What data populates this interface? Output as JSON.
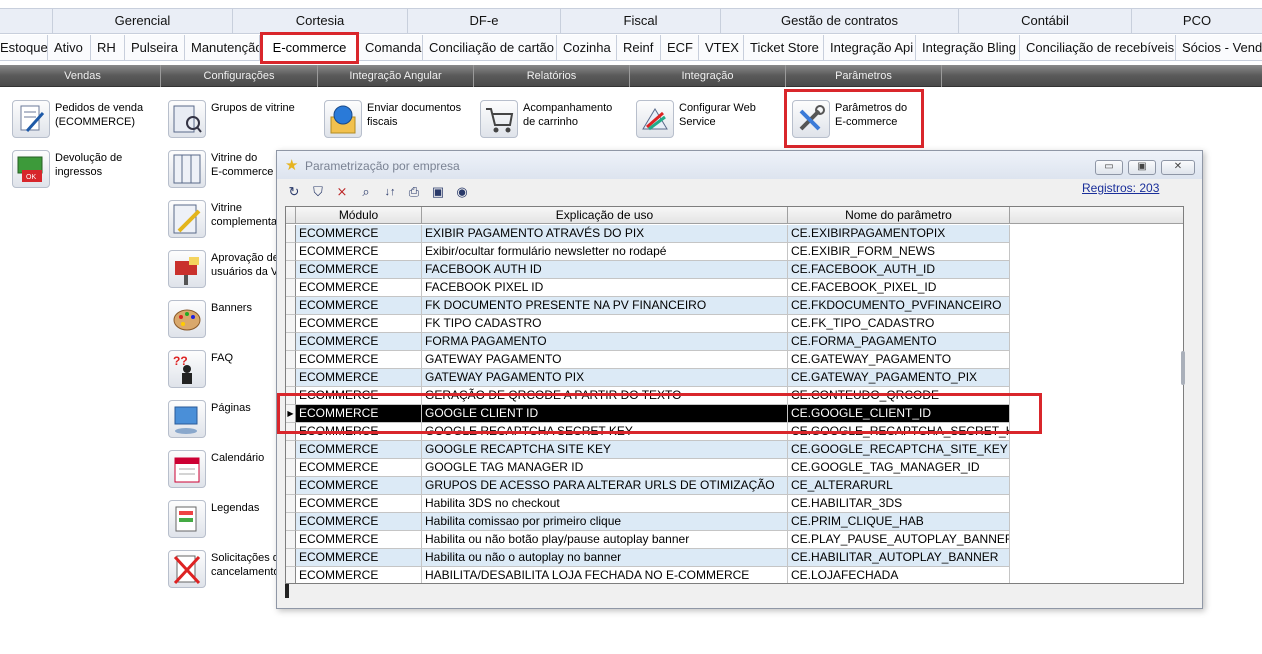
{
  "top_menu": [
    "Gerencial",
    "Cortesia",
    "DF-e",
    "Fiscal",
    "Gestão de contratos",
    "Contábil",
    "PCO"
  ],
  "modules": [
    "Estoque",
    "Ativo",
    "RH",
    "Pulseira",
    "Manutenção",
    "E-commerce",
    "Comanda",
    "Conciliação de cartão",
    "Cozinha",
    "Reinf",
    "ECF",
    "VTEX",
    "Ticket Store",
    "Integração Api",
    "Integração Bling",
    "Conciliação de recebíveis",
    "Sócios - Venda"
  ],
  "selected_module": "E-commerce",
  "sub_menu": [
    "Vendas",
    "Configurações",
    "Integração Angular",
    "Relatórios",
    "Integração",
    "Parâmetros"
  ],
  "tiles": {
    "pedidos": "Pedidos de venda\n(ECOMMERCE)",
    "devolucao": "Devolução de\ningressos",
    "grupos_vitrine": "Grupos de vitrine",
    "vitrine_ecommerce": "Vitrine do\nE-commerce",
    "vitrine_complementar": "Vitrine\ncomplementar",
    "aprovacao": "Aprovação de\nusuários da V",
    "banners": "Banners",
    "faq": "FAQ",
    "paginas": "Páginas",
    "calendario": "Calendário",
    "legendas": "Legendas",
    "solicitacoes": "Solicitações d\ncancelamento",
    "enviar_docs": "Enviar documentos\nfiscais",
    "carrinho": "Acompanhamento\nde carrinho",
    "web_service": "Configurar Web\nService",
    "parametros": "Parâmetros do\nE-commerce"
  },
  "dialog": {
    "title": "Parametrização por empresa",
    "registros": "Registros: 203",
    "columns": [
      "Módulo",
      "Explicação de uso",
      "Nome do parâmetro"
    ],
    "rows": [
      [
        "ECOMMERCE",
        "EXIBIR PAGAMENTO ATRAVÉS DO PIX",
        "CE.EXIBIRPAGAMENTOPIX"
      ],
      [
        "ECOMMERCE",
        "Exibir/ocultar formulário newsletter no rodapé",
        "CE.EXIBIR_FORM_NEWS"
      ],
      [
        "ECOMMERCE",
        "FACEBOOK AUTH ID",
        "CE.FACEBOOK_AUTH_ID"
      ],
      [
        "ECOMMERCE",
        "FACEBOOK PIXEL ID",
        "CE.FACEBOOK_PIXEL_ID"
      ],
      [
        "ECOMMERCE",
        "FK DOCUMENTO PRESENTE NA PV FINANCEIRO",
        "CE.FKDOCUMENTO_PVFINANCEIRO"
      ],
      [
        "ECOMMERCE",
        "FK TIPO CADASTRO",
        "CE.FK_TIPO_CADASTRO"
      ],
      [
        "ECOMMERCE",
        "FORMA PAGAMENTO",
        "CE.FORMA_PAGAMENTO"
      ],
      [
        "ECOMMERCE",
        "GATEWAY PAGAMENTO",
        "CE.GATEWAY_PAGAMENTO"
      ],
      [
        "ECOMMERCE",
        "GATEWAY PAGAMENTO PIX",
        "CE.GATEWAY_PAGAMENTO_PIX"
      ],
      [
        "ECOMMERCE",
        "GERAÇÃO DE QRCODE A PARTIR DO TEXTO",
        "CE.CONTEUDO_QRCODE"
      ],
      [
        "ECOMMERCE",
        "GOOGLE CLIENT ID",
        "CE.GOOGLE_CLIENT_ID"
      ],
      [
        "ECOMMERCE",
        "GOOGLE RECAPTCHA SECRET KEY",
        "CE.GOOGLE_RECAPTCHA_SECRET_K"
      ],
      [
        "ECOMMERCE",
        "GOOGLE RECAPTCHA SITE KEY",
        "CE.GOOGLE_RECAPTCHA_SITE_KEY"
      ],
      [
        "ECOMMERCE",
        "GOOGLE TAG MANAGER ID",
        "CE.GOOGLE_TAG_MANAGER_ID"
      ],
      [
        "ECOMMERCE",
        "GRUPOS DE ACESSO PARA ALTERAR URLS DE OTIMIZAÇÃO",
        "CE_ALTERARURL"
      ],
      [
        "ECOMMERCE",
        "Habilita 3DS no checkout",
        "CE.HABILITAR_3DS"
      ],
      [
        "ECOMMERCE",
        "Habilita comissao por primeiro clique",
        "CE.PRIM_CLIQUE_HAB"
      ],
      [
        "ECOMMERCE",
        "Habilita ou não botão play/pause autoplay banner",
        "CE.PLAY_PAUSE_AUTOPLAY_BANNER"
      ],
      [
        "ECOMMERCE",
        "Habilita ou não o autoplay no banner",
        "CE.HABILITAR_AUTOPLAY_BANNER"
      ],
      [
        "ECOMMERCE",
        "HABILITA/DESABILITA LOJA FECHADA NO E-COMMERCE",
        "CE.LOJAFECHADA"
      ]
    ],
    "selected_row": 10
  },
  "colors": {
    "highlight": "#d9262b",
    "row_alt": "#dceaf6",
    "subbar": "#5a5a5a"
  }
}
